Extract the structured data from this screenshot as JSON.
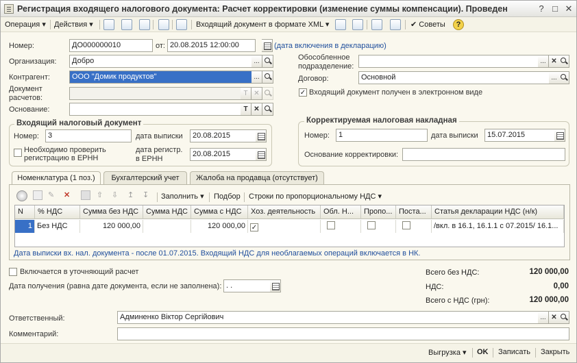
{
  "window": {
    "title": "Регистрация входящего налогового документа: Расчет корректировки (изменение суммы компенсации). Проведен"
  },
  "toolbar": {
    "operation": "Операция",
    "actions": "Действия",
    "incoming_xml": "Входящий документ в формате XML",
    "tips": "Советы"
  },
  "form": {
    "number_label": "Номер:",
    "number_value": "ДО000000010",
    "from_label": "от:",
    "date_value": "20.08.2015 12:00:00",
    "declaration_link": "(дата включения в декларацию)",
    "org_label": "Организация:",
    "org_value": "Добро",
    "counterparty_label": "Контрагент:",
    "counterparty_value": "ООО \"Домик продуктов\"",
    "settlement_doc_label_1": "Документ",
    "settlement_doc_label_2": "расчетов:",
    "basis_label": "Основание:",
    "division_label_1": "Обособленное",
    "division_label_2": "подразделение:",
    "contract_label": "Договор:",
    "contract_value": "Основной",
    "electronic_label": "Входящий документ получен в электронном виде"
  },
  "incoming_group": {
    "title": "Входящий налоговый документ",
    "number_label": "Номер:",
    "number_value": "3",
    "issue_date_label": "дата выписки",
    "issue_date_value": "20.08.2015",
    "check_label_1": "Необходимо проверить",
    "check_label_2": "регистрацию в ЕРНН",
    "reg_date_label_1": "дата регистр.",
    "reg_date_label_2": "в ЕРНН",
    "reg_date_value": "20.08.2015"
  },
  "corrected_group": {
    "title": "Корректируемая налоговая накладная",
    "number_label": "Номер:",
    "number_value": "1",
    "issue_date_label": "дата выписки",
    "issue_date_value": "15.07.2015",
    "basis_label": "Основание корректировки:"
  },
  "tabs": [
    {
      "label": "Номенклатура (1 поз.)"
    },
    {
      "label": "Бухгалтерский учет"
    },
    {
      "label": "Жалоба на продавца (отсутствует)"
    }
  ],
  "table_toolbar": {
    "fill": "Заполнить",
    "selection": "Подбор",
    "proportional": "Строки по пропорциональному НДС"
  },
  "table": {
    "headers": [
      "N",
      "% НДС",
      "Сумма без НДС",
      "Сумма НДС",
      "Сумма с НДС",
      "Хоз. деятельность",
      "Обл. Н...",
      "Пропо...",
      "Поста...",
      "Статья декларации НДС (н/к)"
    ],
    "rows": [
      [
        "1",
        "Без НДС",
        "120 000,00",
        "",
        "120 000,00",
        "✓",
        "",
        "",
        "",
        "/вкл. в 16.1, 16.1.1 с 07.2015/ 16.1..."
      ]
    ]
  },
  "info_text": "Дата выписки вх. нал. документа - после 01.07.2015. Входящий НДС для необлагаемых операций включается в НК.",
  "lower": {
    "refining_label": "Включается в уточняющий расчет",
    "receipt_date_label": "Дата получения (равна дате документа, если не заполнена):",
    "receipt_date_value": " .  .  ",
    "responsible_label": "Ответственный:",
    "responsible_value": "Админенко Віктор Сергійович",
    "comment_label": "Комментарий:"
  },
  "totals": {
    "without_vat_label": "Всего без НДС:",
    "without_vat_value": "120 000,00",
    "vat_label": "НДС:",
    "vat_value": "0,00",
    "with_vat_label": "Всего с НДС (грн):",
    "with_vat_value": "120 000,00"
  },
  "bottom": {
    "export": "Выгрузка",
    "ok": "OK",
    "save": "Записать",
    "close": "Закрыть"
  }
}
